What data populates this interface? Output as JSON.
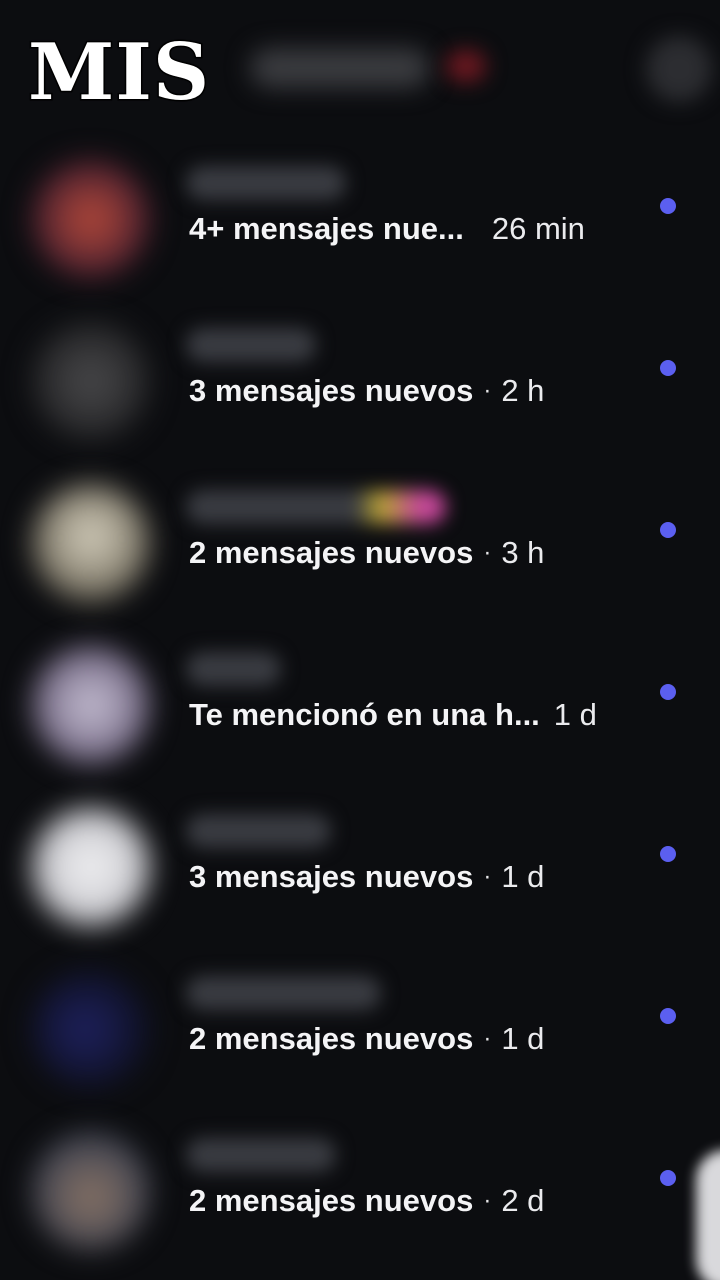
{
  "overlay": {
    "title": "MIS"
  },
  "accent_color": "#5b5ff0",
  "header": {
    "username": "",
    "action_icon": "settings-icon"
  },
  "notifications": [
    {
      "message": "4+ mensajes nue...",
      "time": "26 min",
      "separator": "",
      "unread": true,
      "avatar_color": "#a23a2e"
    },
    {
      "message": "3 mensajes nuevos",
      "time": "2 h",
      "separator": "·",
      "unread": true,
      "avatar_color": "#3a3a3c"
    },
    {
      "message": "2 mensajes nuevos",
      "time": "3 h",
      "separator": "·",
      "unread": true,
      "avatar_color": "#8c8675"
    },
    {
      "message": "Te mencionó en una h...",
      "time": "1 d",
      "separator": "",
      "unread": true,
      "avatar_color": "#9a8fa6"
    },
    {
      "message": "3 mensajes nuevos",
      "time": "1 d",
      "separator": "·",
      "unread": true,
      "avatar_color": "#e2e2e6"
    },
    {
      "message": "2 mensajes nuevos",
      "time": "1 d",
      "separator": "·",
      "unread": true,
      "avatar_color": "#1e2150"
    },
    {
      "message": "2 mensajes nuevos",
      "time": "2 d",
      "separator": "·",
      "unread": true,
      "avatar_color": "#6a5a4e"
    }
  ]
}
